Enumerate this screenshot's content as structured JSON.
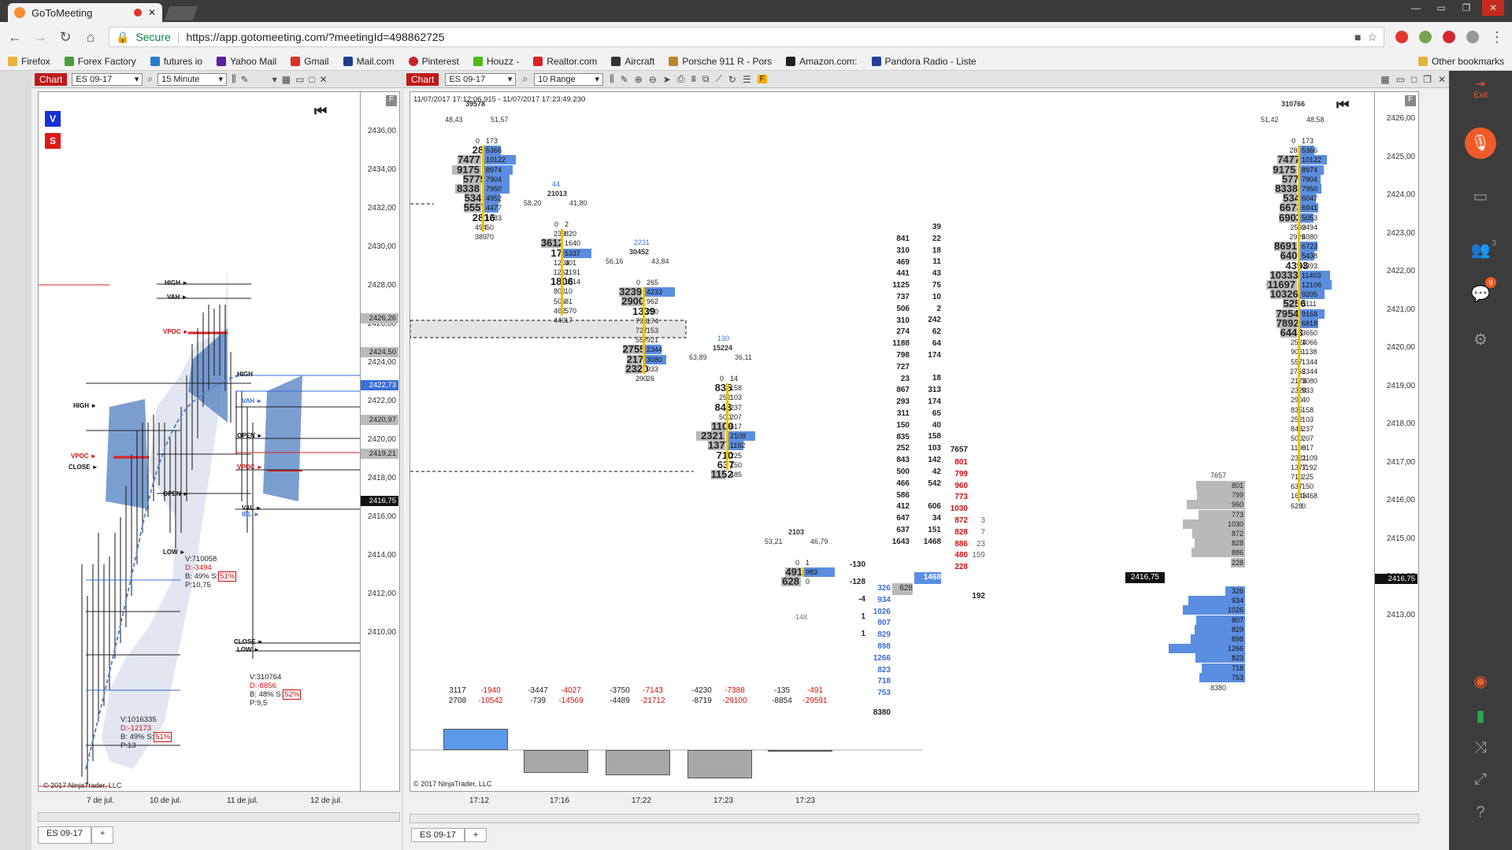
{
  "browser": {
    "tab_title": "GoToMeeting",
    "url_secure": "Secure",
    "url": "https://app.gotomeeting.com/?meetingId=498862725",
    "bookmarks": [
      "Firefox",
      "Forex Factory",
      "futures io",
      "Yahoo Mail",
      "Gmail",
      "Mail.com",
      "Pinterest",
      "Houzz -",
      "Realtor.com",
      "Aircraft",
      "Porsche 911 R - Pors",
      "Amazon.com:",
      "Pandora Radio - Liste"
    ],
    "other_bookmarks": "Other bookmarks"
  },
  "g2m": {
    "exit_label": "Exit",
    "attendees_count": "3",
    "chat_count": "9"
  },
  "left_chart": {
    "chart_label": "Chart",
    "instrument": "ES 09-17",
    "interval": "15 Minute",
    "v_btn": "V",
    "s_btn": "S",
    "y_ticks": [
      "2436,00",
      "2434,00",
      "2432,00",
      "2430,00",
      "2428,00",
      "2426,00",
      "2424,00",
      "2422,00",
      "2420,00",
      "2418,00",
      "2416,00",
      "2414,00",
      "2412,00",
      "2410,00"
    ],
    "y_marks": [
      {
        "label": "2426,26",
        "style": "gray"
      },
      {
        "label": "2424,50",
        "style": "gray"
      },
      {
        "label": "2422,73",
        "style": "blue"
      },
      {
        "label": "2420,97",
        "style": "gray"
      },
      {
        "label": "2419,21",
        "style": "gray"
      },
      {
        "label": "2416,75",
        "style": "dark"
      }
    ],
    "levels": [
      "HIGH ►",
      "VAH ►",
      "VPOC ►",
      "HIGH ►",
      "VPOC ►",
      "CLOSE ►",
      "OPEN ►",
      "LOW ►",
      "HIGH",
      "VAH ►",
      "OPEN ►",
      "VPOC ►",
      "VAL ►",
      "IBL ►",
      "CLOSE ►",
      "LOW ►"
    ],
    "info1": {
      "v": "V:710058",
      "d": "D:-3494",
      "b": "B: 49%",
      "s": "S:",
      "s_pct": "51%",
      "p": "P:10,75"
    },
    "info2": {
      "v": "V:310764",
      "d": "D:-8856",
      "b": "B: 48%",
      "s": "S:",
      "s_pct": "52%",
      "p": "P:9,5"
    },
    "info3": {
      "v": "V:1016335",
      "d": "D:-12173",
      "b": "B: 49%",
      "s": "S:",
      "s_pct": "51%",
      "p": "P:13"
    },
    "copyright": "© 2017 NinjaTrader, LLC",
    "x_labels": [
      "7 de jul.",
      "10 de jul.",
      "11 de jul.",
      "12 de jul."
    ],
    "tab": "ES 09-17",
    "add_tab": "+"
  },
  "right_chart": {
    "chart_label": "Chart",
    "instrument": "ES 09-17",
    "interval": "10 Range",
    "date_range": "11/07/2017 17:12:06.915 - 11/07/2017 17:23:49.230",
    "copyright": "© 2017 NinjaTrader, LLC",
    "y_ticks": [
      "2426,00",
      "2425,00",
      "2424,00",
      "2423,00",
      "2422,00",
      "2421,00",
      "2420,00",
      "2419,00",
      "2418,00",
      "2417,00",
      "2416,00",
      "2415,00",
      "2414,00",
      "2413,00"
    ],
    "price_tag": "2416,75",
    "price_tag_left": "2416,75",
    "x_labels": [
      "17:12",
      "17:16",
      "17:22",
      "17:23",
      "17:23"
    ],
    "tab": "ES 09-17",
    "add_tab": "+",
    "bar1": {
      "top_vol": "39578",
      "bid_pct": "48,43",
      "ask_pct": "51,57",
      "rows": [
        [
          "0",
          "173"
        ],
        [
          "2834",
          "5366"
        ],
        [
          "7477",
          "10122"
        ],
        [
          "9175",
          "8974"
        ],
        [
          "5775",
          "7904"
        ],
        [
          "8338",
          "7950"
        ],
        [
          "5349",
          "4952"
        ],
        [
          "5557",
          "4477"
        ],
        [
          "2816",
          "1283"
        ],
        [
          "494",
          "50"
        ],
        [
          "389",
          "70"
        ]
      ]
    },
    "bar2": {
      "delta_top": "44",
      "vol": "21013",
      "bid_pct": "58,20",
      "ask_pct": "41,80",
      "rows": [
        [
          "0",
          "2"
        ],
        [
          "233",
          "820"
        ],
        [
          "3612",
          "1640"
        ],
        [
          "1746",
          "5337"
        ],
        [
          "1204",
          "301"
        ],
        [
          "1261",
          "2191"
        ],
        [
          "1806",
          "1814"
        ],
        [
          "806",
          "10"
        ],
        [
          "506",
          "81"
        ],
        [
          "462",
          "570"
        ],
        [
          "440",
          "17"
        ]
      ]
    },
    "bar3": {
      "delta_top": "2231",
      "vol": "30452",
      "bid_pct": "56,16",
      "ask_pct": "43,84",
      "rows": [
        [
          "0",
          "265"
        ],
        [
          "3239",
          "4233"
        ],
        [
          "2900",
          "962"
        ],
        [
          "1339",
          "260"
        ],
        [
          "798",
          "174"
        ],
        [
          "727",
          "153"
        ],
        [
          "557",
          "921"
        ],
        [
          "2755",
          "2344"
        ],
        [
          "2176",
          "3080"
        ],
        [
          "2320",
          "933"
        ],
        [
          "290",
          "26"
        ]
      ]
    },
    "bar4": {
      "delta_top": "130",
      "vol": "15224",
      "bid_pct": "63,89",
      "ask_pct": "36,11",
      "rows": [
        [
          "0",
          "14"
        ],
        [
          "835",
          "158"
        ],
        [
          "252",
          "103"
        ],
        [
          "843",
          "237"
        ],
        [
          "500",
          "207"
        ],
        [
          "1100",
          "617"
        ],
        [
          "2321",
          "2109"
        ],
        [
          "1377",
          "1192"
        ],
        [
          "710",
          "225"
        ],
        [
          "637",
          "150"
        ],
        [
          "1152",
          "485"
        ]
      ]
    },
    "bar5": {
      "vol": "2103",
      "vol_sub": "-148",
      "bid_pct": "53,21",
      "ask_pct": "46,79",
      "rows": [
        [
          "0",
          "1"
        ],
        [
          "491",
          "983"
        ],
        [
          "628",
          "0"
        ]
      ]
    },
    "deltas": [
      {
        "a": "3117",
        "b": "-1940",
        "c": "2708",
        "d": "-10542"
      },
      {
        "a": "-3447",
        "b": "-4027",
        "c": "-739",
        "d": "-14569"
      },
      {
        "a": "-3750",
        "b": "-7143",
        "c": "-4489",
        "d": "-21712"
      },
      {
        "a": "-4230",
        "b": "-7388",
        "c": "-8719",
        "d": "-29100"
      },
      {
        "a": "-135",
        "b": "-491",
        "c": "-8854",
        "d": "-29591"
      }
    ],
    "col_bid": [
      "841",
      "310",
      "469",
      "441",
      "1125",
      "737",
      "506",
      "310",
      "274",
      "1188",
      "798",
      "727",
      "23",
      "867",
      "293",
      "311",
      "150",
      "835",
      "252",
      "843",
      "500",
      "466",
      "586",
      "412",
      "647",
      "637",
      "1643"
    ],
    "col_ask": [
      "39",
      "22",
      "18",
      "11",
      "43",
      "75",
      "10",
      "2",
      "242",
      "62",
      "64",
      "174",
      "",
      "18",
      "313",
      "174",
      "65",
      "40",
      "158",
      "103",
      "142",
      "42",
      "542",
      "",
      "606",
      "34",
      "151",
      "1468"
    ],
    "col_red": [
      "801",
      "799",
      "960",
      "773",
      "1030",
      "872",
      "828",
      "886",
      "480",
      "228"
    ],
    "col_red_head": "7657",
    "col_small": [
      "3",
      "7",
      "23",
      "159"
    ],
    "col_small_extra": "192",
    "col_left": [
      "-130",
      "-128",
      "-4",
      "1",
      "1"
    ],
    "col_blue": [
      "326",
      "934",
      "1026",
      "807",
      "829",
      "898",
      "1266",
      "823",
      "718",
      "753"
    ],
    "col_blue_foot": "8380",
    "col_bid_last": "628",
    "profile_vol_top": "7657",
    "profile_vol_bottom": "8380",
    "profile_gray": [
      "801",
      "799",
      "960",
      "773",
      "1030",
      "872",
      "828",
      "886",
      "228"
    ],
    "profile_blue": [
      "326",
      "934",
      "1026",
      "807",
      "829",
      "898",
      "1266",
      "823",
      "718",
      "753"
    ],
    "bar6": {
      "top_vol": "310766",
      "bid_pct": "51,42",
      "ask_pct": "48,58",
      "rows": [
        [
          "0",
          "173"
        ],
        [
          "2834",
          "5366"
        ],
        [
          "7477",
          "10122"
        ],
        [
          "9175",
          "8974"
        ],
        [
          "5775",
          "7904"
        ],
        [
          "8338",
          "7950"
        ],
        [
          "5349",
          "6047"
        ],
        [
          "6673",
          "6941"
        ],
        [
          "6903",
          "5053"
        ],
        [
          "2599",
          "2494"
        ],
        [
          "2925",
          "4080"
        ],
        [
          "8691",
          "6723"
        ],
        [
          "6403",
          "5438"
        ],
        [
          "4393",
          "4393"
        ],
        [
          "10333",
          "11403"
        ],
        [
          "11697",
          "12106"
        ],
        [
          "10326",
          "9205"
        ],
        [
          "5256",
          "3111"
        ],
        [
          "7954",
          "9168"
        ],
        [
          "7892",
          "6818"
        ],
        [
          "6443",
          "3650"
        ],
        [
          "2524",
          "1066"
        ],
        [
          "906",
          "1138"
        ],
        [
          "557",
          "1344"
        ],
        [
          "2755",
          "2344"
        ],
        [
          "2176",
          "3080"
        ],
        [
          "2320",
          "933"
        ],
        [
          "290",
          "40"
        ],
        [
          "835",
          "158"
        ],
        [
          "252",
          "103"
        ],
        [
          "843",
          "237"
        ],
        [
          "500",
          "207"
        ],
        [
          "1100",
          "617"
        ],
        [
          "2321",
          "2109"
        ],
        [
          "1377",
          "1192"
        ],
        [
          "710",
          "225"
        ],
        [
          "637",
          "150"
        ],
        [
          "1643",
          "1468"
        ],
        [
          "628",
          "0"
        ]
      ]
    }
  }
}
